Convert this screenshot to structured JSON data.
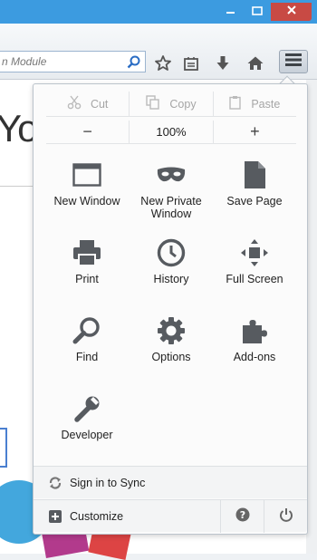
{
  "window": {
    "controls": {
      "minimize_icon": "minimize-icon",
      "maximize_icon": "maximize-icon",
      "close_icon": "close-icon"
    }
  },
  "toolbar": {
    "url_text": "n Module",
    "icons": [
      "search-icon",
      "star-icon",
      "reading-list-icon",
      "download-icon",
      "home-icon",
      "menu-icon"
    ]
  },
  "page": {
    "partial_heading": "You"
  },
  "menu": {
    "edit": {
      "cut": "Cut",
      "copy": "Copy",
      "paste": "Paste"
    },
    "zoom": {
      "minus": "−",
      "level": "100%",
      "plus": "+"
    },
    "items": [
      {
        "label": "New Window",
        "icon": "new-window-icon"
      },
      {
        "label": "New Private Window",
        "icon": "private-mask-icon"
      },
      {
        "label": "Save Page",
        "icon": "save-page-icon"
      },
      {
        "label": "Print",
        "icon": "print-icon"
      },
      {
        "label": "History",
        "icon": "history-clock-icon"
      },
      {
        "label": "Full Screen",
        "icon": "full-screen-icon"
      },
      {
        "label": "Find",
        "icon": "find-magnifier-icon"
      },
      {
        "label": "Options",
        "icon": "options-gear-icon"
      },
      {
        "label": "Add-ons",
        "icon": "add-ons-puzzle-icon"
      },
      {
        "label": "Developer",
        "icon": "developer-wrench-icon"
      }
    ],
    "sync_label": "Sign in to Sync",
    "customize_label": "Customize",
    "help_icon": "help-icon",
    "quit_icon": "power-icon"
  },
  "colors": {
    "titlebar": "#3c9be0",
    "close_button": "#c84a44",
    "icon_gray": "#575b60"
  }
}
